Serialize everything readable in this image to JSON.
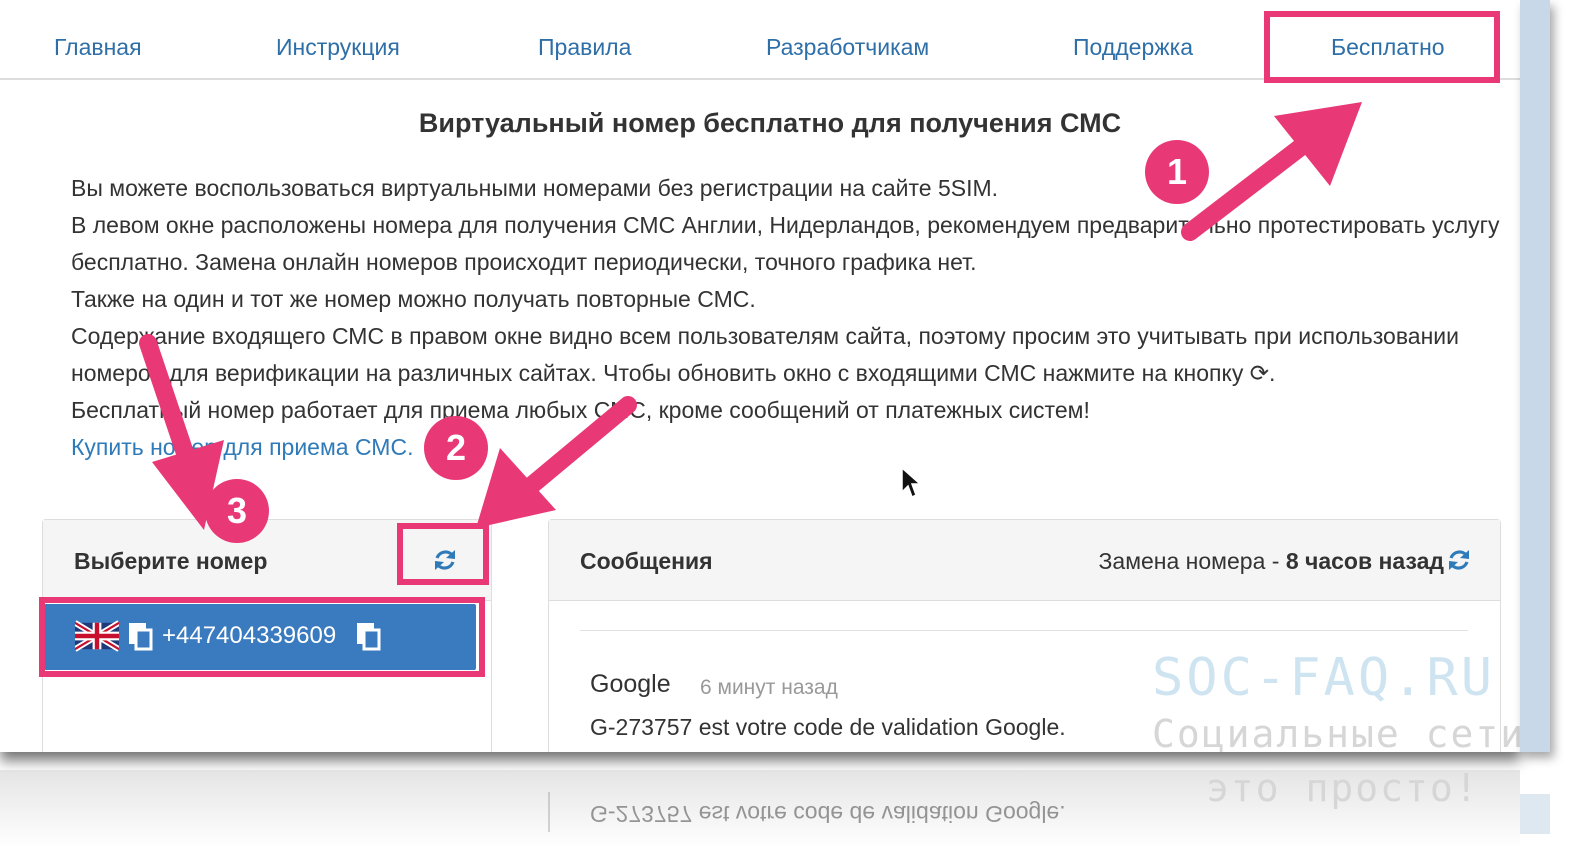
{
  "nav": {
    "items": [
      {
        "label": "Главная"
      },
      {
        "label": "Инструкция"
      },
      {
        "label": "Правила"
      },
      {
        "label": "Разработчикам"
      },
      {
        "label": "Поддержка"
      },
      {
        "label": "Бесплатно"
      }
    ]
  },
  "main": {
    "title": "Виртуальный номер бесплатно для получения СМС",
    "paragraphs": [
      "Вы можете воспользоваться виртуальными номерами без регистрации на сайте 5SIM.",
      "В левом окне расположены номера для получения СМС Англии, Нидерландов, рекомендуем предварительно протестировать услугу бесплатно. Замена онлайн номеров происходит периодически, точного графика нет.",
      "Также на один и тот же номер можно получать повторные СМС.",
      "Содержание входящего СМС в правом окне видно всем пользователям сайта, поэтому просим это учитывать при использовании номеров для верификации на различных сайтах. Чтобы обновить окно с входящими СМС нажмите на кнопку ⟳.",
      "Бесплатный номер работает для приема любых СМС, кроме сообщений от платежных систем!"
    ],
    "buy_link": "Купить номер для приема СМС."
  },
  "numbers_panel": {
    "title": "Выберите номер",
    "refresh_icon": "refresh-icon",
    "number": "+447404339609",
    "flag_icon": "uk-flag-icon"
  },
  "messages_panel": {
    "title": "Сообщения",
    "replace_prefix": "Замена номера - ",
    "replace_time": "8 часов назад",
    "messages": [
      {
        "sender": "Google",
        "time": "6 минут назад",
        "text": "G-273757 est votre code de validation Google."
      }
    ]
  },
  "annotations": {
    "badges": [
      "1",
      "2",
      "3"
    ],
    "color": "#e93876"
  },
  "watermark": {
    "site": "SOC-FAQ.RU",
    "line1": "Социальные сети",
    "line2": "это просто!"
  },
  "colors": {
    "link": "#2f6fa8",
    "number_bg": "#3a7bbf",
    "accent": "#e93876"
  }
}
